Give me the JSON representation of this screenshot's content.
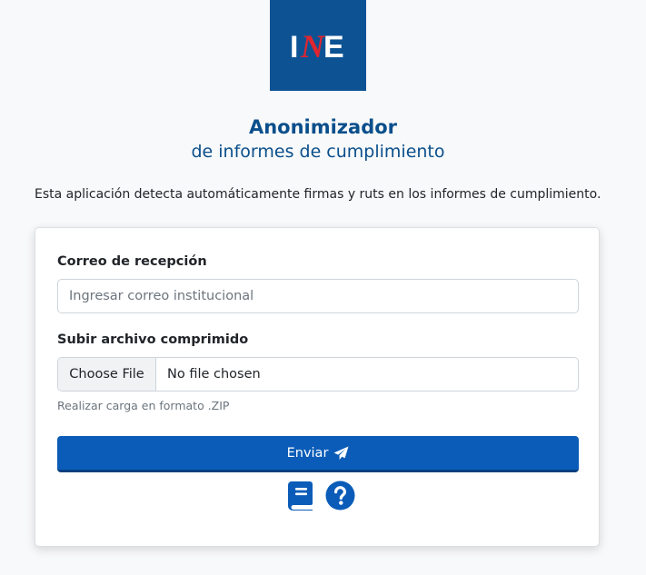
{
  "logo": {
    "text_left": "I",
    "text_middle": "N",
    "text_right": "E",
    "background_color": "#0d5394",
    "accent_color": "#e0252f"
  },
  "header": {
    "title": "Anonimizador",
    "subtitle": "de informes de cumplimiento"
  },
  "description": "Esta aplicación detecta automáticamente firmas y ruts en los informes de cumplimiento.",
  "form": {
    "email_label": "Correo de recepción",
    "email_placeholder": "Ingresar correo institucional",
    "email_value": "",
    "file_label": "Subir archivo comprimido",
    "file_button_label": "Choose File",
    "file_status": "No file chosen",
    "file_help": "Realizar carga en formato .ZIP",
    "submit_label": "Enviar",
    "submit_icon": "paper-plane-icon",
    "primary_color": "#0b5cb8"
  },
  "footer_icons": [
    {
      "name": "book-icon"
    },
    {
      "name": "question-circle-icon"
    }
  ]
}
